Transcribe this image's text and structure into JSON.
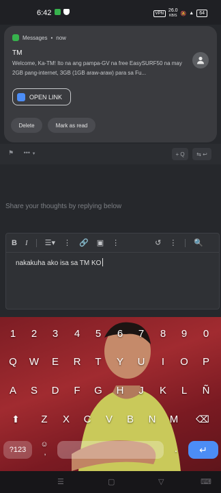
{
  "status_bar": {
    "time": "6:42",
    "vpn": "VPN",
    "speed_value": "26.0",
    "speed_unit": "KB/S",
    "battery": "64"
  },
  "notification": {
    "app_name": "Messages",
    "time": "now",
    "title": "TM",
    "body": "Welcome, Ka-TM! Ito na ang pampa-GV na free EasySURF50 na may 2GB pang-internet, 3GB (1GB araw-araw) para sa Fu...",
    "open_link_label": "OPEN LINK",
    "delete_label": "Delete",
    "mark_read_label": "Mark as read"
  },
  "forum": {
    "more_label": "•••",
    "quote_label": "+ Q",
    "prompt": "Share your thoughts by replying below",
    "editor_text": "nakakuha ako isa sa TM KO"
  },
  "editor_toolbar": {
    "bold": "B",
    "italic": "I"
  },
  "keyboard": {
    "row_numbers": [
      "1",
      "2",
      "3",
      "4",
      "5",
      "6",
      "7",
      "8",
      "9",
      "0"
    ],
    "row_1": [
      "Q",
      "W",
      "E",
      "R",
      "T",
      "Y",
      "U",
      "I",
      "O",
      "P"
    ],
    "row_2": [
      "A",
      "S",
      "D",
      "F",
      "G",
      "H",
      "J",
      "K",
      "L",
      "Ñ"
    ],
    "row_3": [
      "Z",
      "X",
      "C",
      "V",
      "B",
      "N",
      "M"
    ],
    "symbols_label": "?123",
    "period": ".",
    "comma": ","
  },
  "colors": {
    "accent_blue": "#4c8df6",
    "keyboard_red": "#a12b30",
    "notif_bg": "#3a3b3f"
  }
}
